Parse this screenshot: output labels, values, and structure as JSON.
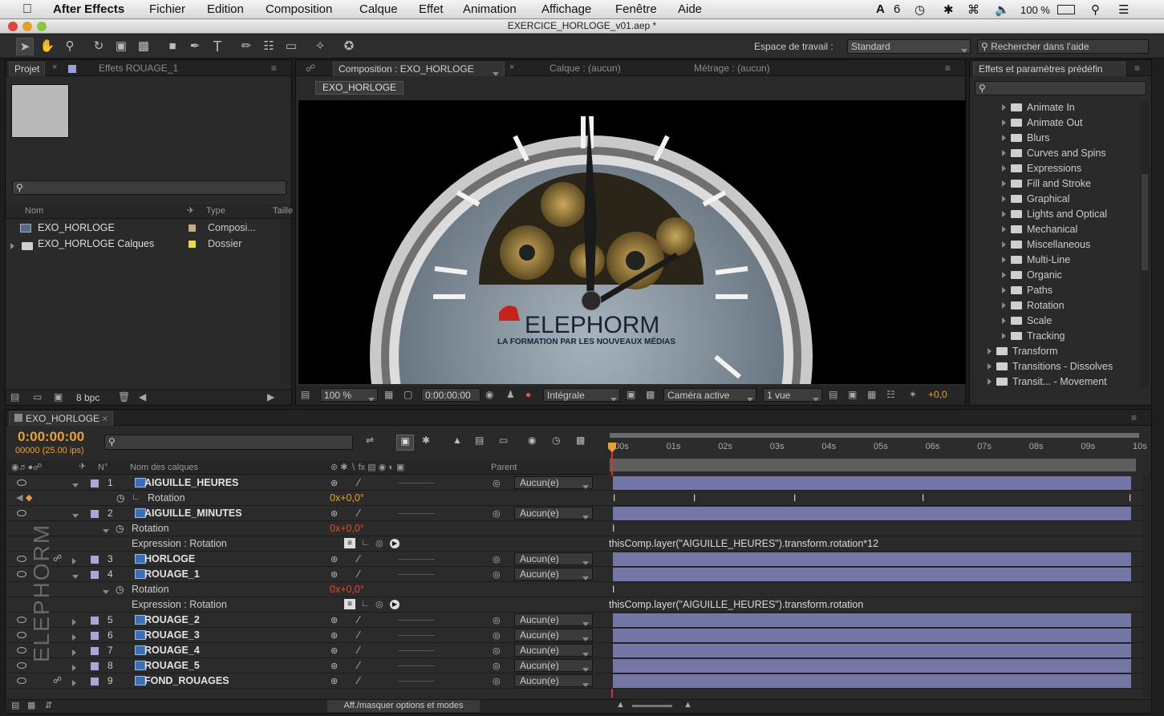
{
  "menubar": {
    "app": "After Effects",
    "items": [
      "Fichier",
      "Edition",
      "Composition",
      "Calque",
      "Effet",
      "Animation",
      "Affichage",
      "Fenêtre",
      "Aide"
    ],
    "status_ai": "6",
    "battery": "100 %"
  },
  "window": {
    "title": "EXERCICE_HORLOGE_v01.aep *"
  },
  "toolbar": {
    "workspace_label": "Espace de travail :",
    "workspace_value": "Standard",
    "search_placeholder": "Rechercher dans l'aide"
  },
  "project": {
    "tab": "Projet",
    "tab2": "Effets ROUAGE_1",
    "col_name": "Nom",
    "col_type": "Type",
    "col_size": "Taille",
    "items": [
      {
        "name": "EXO_HORLOGE",
        "type": "Composi..."
      },
      {
        "name": "EXO_HORLOGE Calques",
        "type": "Dossier"
      }
    ],
    "bpc": "8 bpc"
  },
  "comp": {
    "tab": "Composition : EXO_HORLOGE",
    "tab_layer": "Calque : (aucun)",
    "tab_footage": "Métrage : (aucun)",
    "breadcrumb": "EXO_HORLOGE",
    "brand": "ELEPHORM",
    "tagline": "LA FORMATION PAR LES NOUVEAUX MÉDIAS",
    "zoom": "100 %",
    "time": "0:00:00:00",
    "resolution": "Intégrale",
    "camera": "Caméra active",
    "views": "1 vue",
    "exposure": "+0,0"
  },
  "effects": {
    "tab": "Effets et paramètres prédéfin",
    "items": [
      "Animate In",
      "Animate Out",
      "Blurs",
      "Curves and Spins",
      "Expressions",
      "Fill and Stroke",
      "Graphical",
      "Lights and Optical",
      "Mechanical",
      "Miscellaneous",
      "Multi-Line",
      "Organic",
      "Paths",
      "Rotation",
      "Scale",
      "Tracking"
    ],
    "items2": [
      "Transform",
      "Transitions - Dissolves",
      "Transit... - Movement"
    ]
  },
  "timeline": {
    "tab": "EXO_HORLOGE",
    "timecode": "0:00:00:00",
    "frames": "00000 (25.00 ips)",
    "col_num": "N°",
    "col_name": "Nom des calques",
    "col_parent": "Parent",
    "toggle": "Aff./masquer options et modes",
    "ticks": [
      "00s",
      "01s",
      "02s",
      "03s",
      "04s",
      "05s",
      "06s",
      "07s",
      "08s",
      "09s",
      "10s"
    ],
    "layers": [
      {
        "num": "1",
        "name": "AIGUILLE_HEURES",
        "parent": "Aucun(e)"
      },
      {
        "num": "2",
        "name": "AIGUILLE_MINUTES",
        "parent": "Aucun(e)"
      },
      {
        "num": "3",
        "name": "HORLOGE",
        "parent": "Aucun(e)"
      },
      {
        "num": "4",
        "name": "ROUAGE_1",
        "parent": "Aucun(e)"
      },
      {
        "num": "5",
        "name": "ROUAGE_2",
        "parent": "Aucun(e)"
      },
      {
        "num": "6",
        "name": "ROUAGE_3",
        "parent": "Aucun(e)"
      },
      {
        "num": "7",
        "name": "ROUAGE_4",
        "parent": "Aucun(e)"
      },
      {
        "num": "8",
        "name": "ROUAGE_5",
        "parent": "Aucun(e)"
      },
      {
        "num": "9",
        "name": "FOND_ROUAGES",
        "parent": "Aucun(e)"
      }
    ],
    "prop_rotation": "Rotation",
    "rot_value": "0x+0,0°",
    "expr_label": "Expression : Rotation",
    "expr1": "thisComp.layer(\"AIGUILLE_HEURES\").transform.rotation*12",
    "expr2": "thisComp.layer(\"AIGUILLE_HEURES\").transform.rotation",
    "watermark": "ELEPHORM"
  }
}
